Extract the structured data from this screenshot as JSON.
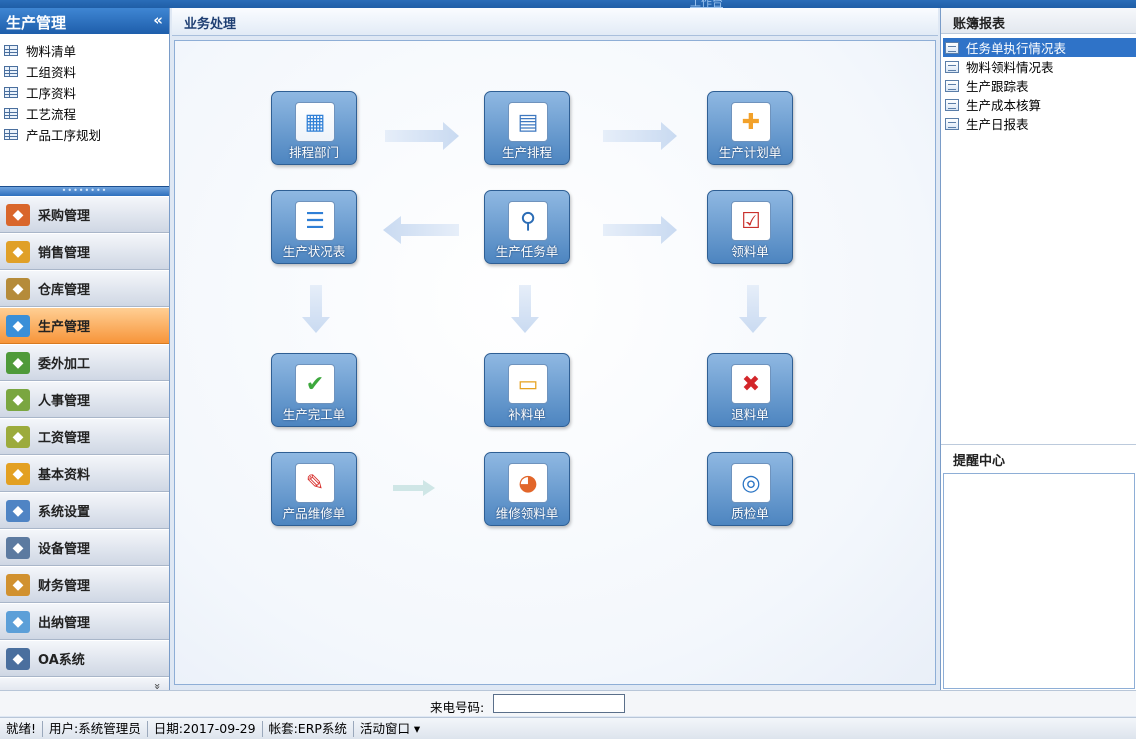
{
  "window": {
    "title": "工作台"
  },
  "left": {
    "module_title": "生产管理",
    "collapse_glyph": "«",
    "sub_items": [
      {
        "label": "物料清单",
        "icon": "table-icon"
      },
      {
        "label": "工组资料",
        "icon": "table-icon"
      },
      {
        "label": "工序资料",
        "icon": "table-icon"
      },
      {
        "label": "工艺流程",
        "icon": "table-icon"
      },
      {
        "label": "产品工序规划",
        "icon": "table-icon"
      }
    ],
    "modules": [
      {
        "label": "采购管理",
        "icon": "shopping-icon",
        "color": "#d9662b"
      },
      {
        "label": "销售管理",
        "icon": "sales-icon",
        "color": "#e0a028"
      },
      {
        "label": "仓库管理",
        "icon": "warehouse-icon",
        "color": "#b58b3a"
      },
      {
        "label": "生产管理",
        "icon": "production-icon",
        "color": "#3a8fd8",
        "active": true
      },
      {
        "label": "委外加工",
        "icon": "outsourcing-icon",
        "color": "#4f9a3a"
      },
      {
        "label": "人事管理",
        "icon": "people-icon",
        "color": "#7aa640"
      },
      {
        "label": "工资管理",
        "icon": "salary-icon",
        "color": "#9cab3c"
      },
      {
        "label": "基本资料",
        "icon": "gear-icon",
        "color": "#e3a022"
      },
      {
        "label": "系统设置",
        "icon": "settings-icon",
        "color": "#4f84c4"
      },
      {
        "label": "设备管理",
        "icon": "equipment-icon",
        "color": "#5c7aa0"
      },
      {
        "label": "财务管理",
        "icon": "finance-icon",
        "color": "#d1912f"
      },
      {
        "label": "出纳管理",
        "icon": "cashier-icon",
        "color": "#5c9fd8"
      },
      {
        "label": "OA系统",
        "icon": "oa-icon",
        "color": "#4a6f9e"
      }
    ],
    "more_glyph": "»"
  },
  "center": {
    "title": "业务处理",
    "tiles": [
      {
        "label": "排程部门",
        "icon": "org-chart-icon",
        "glyph": "▦"
      },
      {
        "label": "生产排程",
        "icon": "calendar-icon",
        "glyph": "▤"
      },
      {
        "label": "生产计划单",
        "icon": "plan-add-icon",
        "glyph": "✚"
      },
      {
        "label": "生产状况表",
        "icon": "status-report-icon",
        "glyph": "☰"
      },
      {
        "label": "生产任务单",
        "icon": "task-search-icon",
        "glyph": "⚲"
      },
      {
        "label": "领料单",
        "icon": "checklist-icon",
        "glyph": "☑"
      },
      {
        "label": "生产完工单",
        "icon": "check-icon",
        "glyph": "✔"
      },
      {
        "label": "补料单",
        "icon": "supplement-icon",
        "glyph": "▭"
      },
      {
        "label": "退料单",
        "icon": "return-icon",
        "glyph": "✖"
      },
      {
        "label": "产品维修单",
        "icon": "repair-icon",
        "glyph": "✎"
      },
      {
        "label": "维修领料单",
        "icon": "pie-chart-icon",
        "glyph": "◕"
      },
      {
        "label": "质检单",
        "icon": "inspection-icon",
        "glyph": "◎"
      }
    ]
  },
  "right": {
    "reports_title": "账簿报表",
    "reports": [
      {
        "label": "任务单执行情况表",
        "selected": true
      },
      {
        "label": "物料领料情况表"
      },
      {
        "label": "生产跟踪表"
      },
      {
        "label": "生产成本核算"
      },
      {
        "label": "生产日报表"
      }
    ],
    "reminder_title": "提醒中心"
  },
  "phone": {
    "label": "来电号码:",
    "value": ""
  },
  "status": {
    "ready": "就绪!",
    "user": "用户:系统管理员",
    "date": "日期:2017-09-29",
    "account": "帐套:ERP系统",
    "active_window": "活动窗口 ▾"
  }
}
